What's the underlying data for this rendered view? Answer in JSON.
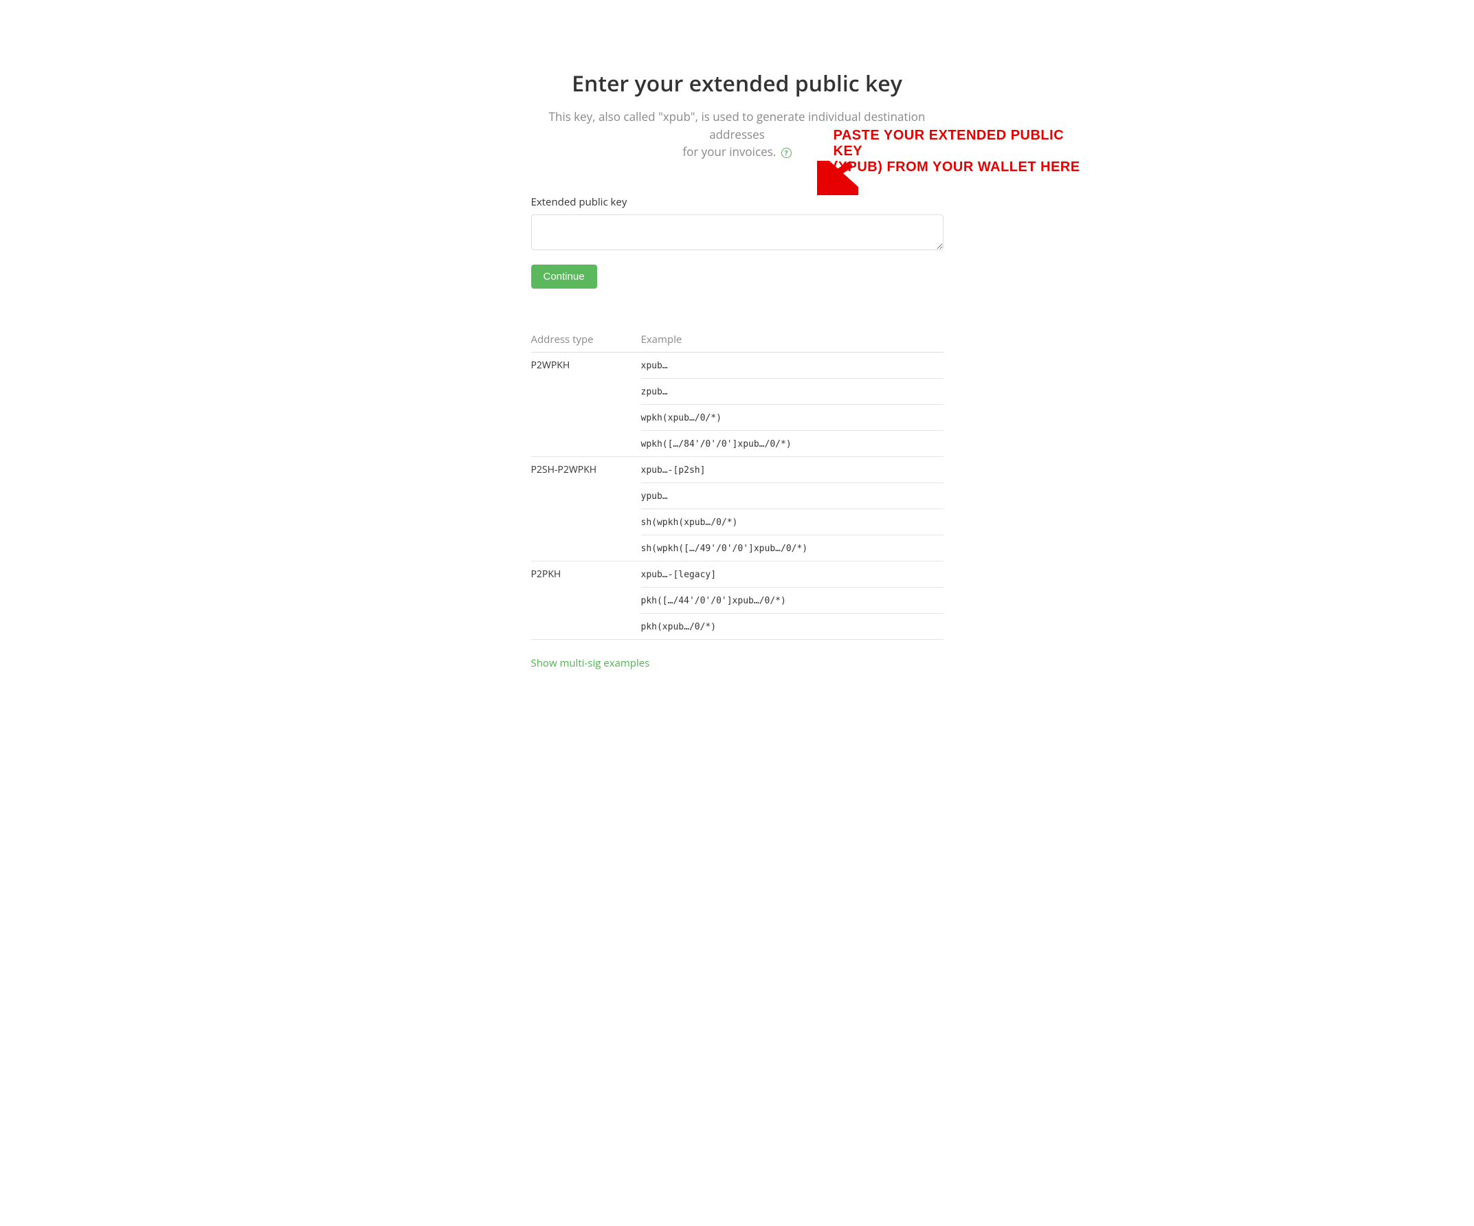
{
  "header": {
    "title": "Enter your extended public key",
    "subtitle_line1": "This key, also called \"xpub\", is used to generate individual destination addresses",
    "subtitle_line2": "for your invoices."
  },
  "form": {
    "label": "Extended public key",
    "textarea_value": "",
    "continue_label": "Continue"
  },
  "annotation": {
    "line1": "PASTE YOUR EXTENDED PUBLIC KEY",
    "line2": "(XPUB) FROM YOUR WALLET HERE"
  },
  "table": {
    "headers": {
      "address_type": "Address type",
      "example": "Example"
    },
    "rows": [
      {
        "type": "P2WPKH",
        "examples": [
          "xpub…",
          "zpub…",
          "wpkh(xpub…/0/*)",
          "wpkh([…/84'/0'/0']xpub…/0/*)"
        ]
      },
      {
        "type": "P2SH-P2WPKH",
        "examples": [
          "xpub…-[p2sh]",
          "ypub…",
          "sh(wpkh(xpub…/0/*)",
          "sh(wpkh([…/49'/0'/0']xpub…/0/*)"
        ]
      },
      {
        "type": "P2PKH",
        "examples": [
          "xpub…-[legacy]",
          "pkh([…/44'/0'/0']xpub…/0/*)",
          "pkh(xpub…/0/*)"
        ]
      }
    ]
  },
  "multisig_link": "Show multi-sig examples"
}
